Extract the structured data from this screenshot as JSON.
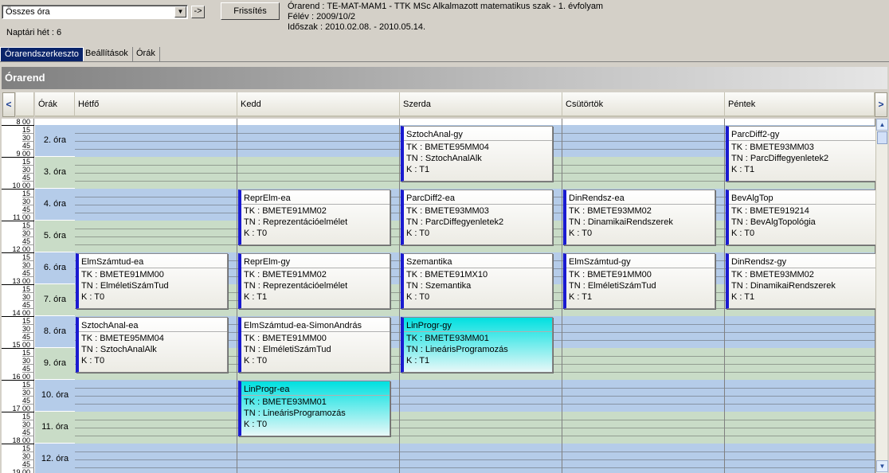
{
  "filter": {
    "combo_value": "Összes óra",
    "go_label": "->",
    "refresh_label": "Frissítés"
  },
  "info": {
    "line1": "Órarend : TE-MAT-MAM1 - TTK MSc Alkalmazott matematikus szak - 1. évfolyam",
    "line2": "Félév : 2009/10/2",
    "line3": "Időszak : 2010.02.08. - 2010.05.14."
  },
  "week_label": "Naptári hét : 6",
  "tabs": [
    {
      "label": "Órarendszerkeszto"
    },
    {
      "label": "Beállítások"
    },
    {
      "label": "Órák"
    }
  ],
  "panel_title": "Órarend",
  "columns": {
    "hours": "Órák",
    "days": [
      "Hétfő",
      "Kedd",
      "Szerda",
      "Csütörtök",
      "Péntek"
    ]
  },
  "nav": {
    "prev": "<",
    "next": ">"
  },
  "time_labels": [
    {
      "hour": "8 00",
      "q": [
        "15",
        "30",
        "45"
      ]
    },
    {
      "hour": "9 00",
      "q": [
        "15",
        "30",
        "45"
      ]
    },
    {
      "hour": "10 00",
      "q": [
        "15",
        "30",
        "45"
      ]
    },
    {
      "hour": "11 00",
      "q": [
        "15",
        "30",
        "45"
      ]
    },
    {
      "hour": "12 00",
      "q": [
        "15",
        "30",
        "45"
      ]
    },
    {
      "hour": "13 00",
      "q": [
        "15",
        "30",
        "45"
      ]
    },
    {
      "hour": "14 00",
      "q": [
        "15",
        "30",
        "45"
      ]
    },
    {
      "hour": "15 00",
      "q": [
        "15",
        "30",
        "45"
      ]
    },
    {
      "hour": "16 00",
      "q": [
        "15",
        "30",
        "45"
      ]
    },
    {
      "hour": "17 00",
      "q": [
        "15",
        "30",
        "45"
      ]
    },
    {
      "hour": "18 00",
      "q": [
        "15",
        "30",
        "45"
      ]
    },
    {
      "hour": "19 00",
      "q": []
    }
  ],
  "periods": [
    "2. óra",
    "3. óra",
    "4. óra",
    "5. óra",
    "6. óra",
    "7. óra",
    "8. óra",
    "9. óra",
    "10. óra",
    "11. óra",
    "12. óra"
  ],
  "events": [
    {
      "day": 2,
      "start": 0,
      "title": "SztochAnal-gy",
      "tk": "TK : BMETE95MM04",
      "tn": "TN : SztochAnalAlk",
      "k": "K : T1",
      "color": "normal"
    },
    {
      "day": 4,
      "start": 0,
      "title": "ParcDiff2-gy",
      "tk": "TK : BMETE93MM03",
      "tn": "TN : ParcDiffegyenletek2",
      "k": "K : T1",
      "color": "normal"
    },
    {
      "day": 1,
      "start": 2,
      "title": "ReprElm-ea",
      "tk": "TK : BMETE91MM02",
      "tn": "TN : Reprezentációelmélet",
      "k": "K : T0",
      "color": "normal"
    },
    {
      "day": 2,
      "start": 2,
      "title": "ParcDiff2-ea",
      "tk": "TK : BMETE93MM03",
      "tn": "TN : ParcDiffegyenletek2",
      "k": "K : T0",
      "color": "normal"
    },
    {
      "day": 3,
      "start": 2,
      "title": "DinRendsz-ea",
      "tk": "TK : BMETE93MM02",
      "tn": "TN : DinamikaiRendszerek",
      "k": "K : T0",
      "color": "normal"
    },
    {
      "day": 4,
      "start": 2,
      "title": "BevAlgTop",
      "tk": "TK : BMETE919214",
      "tn": "TN : BevAlgTopológia",
      "k": "K : T0",
      "color": "normal"
    },
    {
      "day": 0,
      "start": 4,
      "title": "ElmSzámtud-ea",
      "tk": "TK : BMETE91MM00",
      "tn": "TN : ElméletiSzámTud",
      "k": "K : T0",
      "color": "normal"
    },
    {
      "day": 1,
      "start": 4,
      "title": "ReprElm-gy",
      "tk": "TK : BMETE91MM02",
      "tn": "TN : Reprezentációelmélet",
      "k": "K : T1",
      "color": "normal"
    },
    {
      "day": 2,
      "start": 4,
      "title": "Szemantika",
      "tk": "TK : BMETE91MX10",
      "tn": "TN : Szemantika",
      "k": "K : T0",
      "color": "normal"
    },
    {
      "day": 3,
      "start": 4,
      "title": "ElmSzámtud-gy",
      "tk": "TK : BMETE91MM00",
      "tn": "TN : ElméletiSzámTud",
      "k": "K : T1",
      "color": "normal"
    },
    {
      "day": 4,
      "start": 4,
      "title": "DinRendsz-gy",
      "tk": "TK : BMETE93MM02",
      "tn": "TN : DinamikaiRendszerek",
      "k": "K : T1",
      "color": "normal"
    },
    {
      "day": 0,
      "start": 6,
      "title": "SztochAnal-ea",
      "tk": "TK : BMETE95MM04",
      "tn": "TN : SztochAnalAlk",
      "k": "K : T0",
      "color": "normal"
    },
    {
      "day": 1,
      "start": 6,
      "title": "ElmSzámtud-ea-SimonAndrás",
      "tk": "TK : BMETE91MM00",
      "tn": "TN : ElméletiSzámTud",
      "k": "K : T0",
      "color": "normal"
    },
    {
      "day": 2,
      "start": 6,
      "title": "LinProgr-gy",
      "tk": "TK : BMETE93MM01",
      "tn": "TN : LineárisProgramozás",
      "k": "K : T1",
      "color": "cyan"
    },
    {
      "day": 1,
      "start": 8,
      "title": "LinProgr-ea",
      "tk": "TK : BMETE93MM01",
      "tn": "TN : LineárisProgramozás",
      "k": "K : T0",
      "color": "cyan"
    }
  ]
}
